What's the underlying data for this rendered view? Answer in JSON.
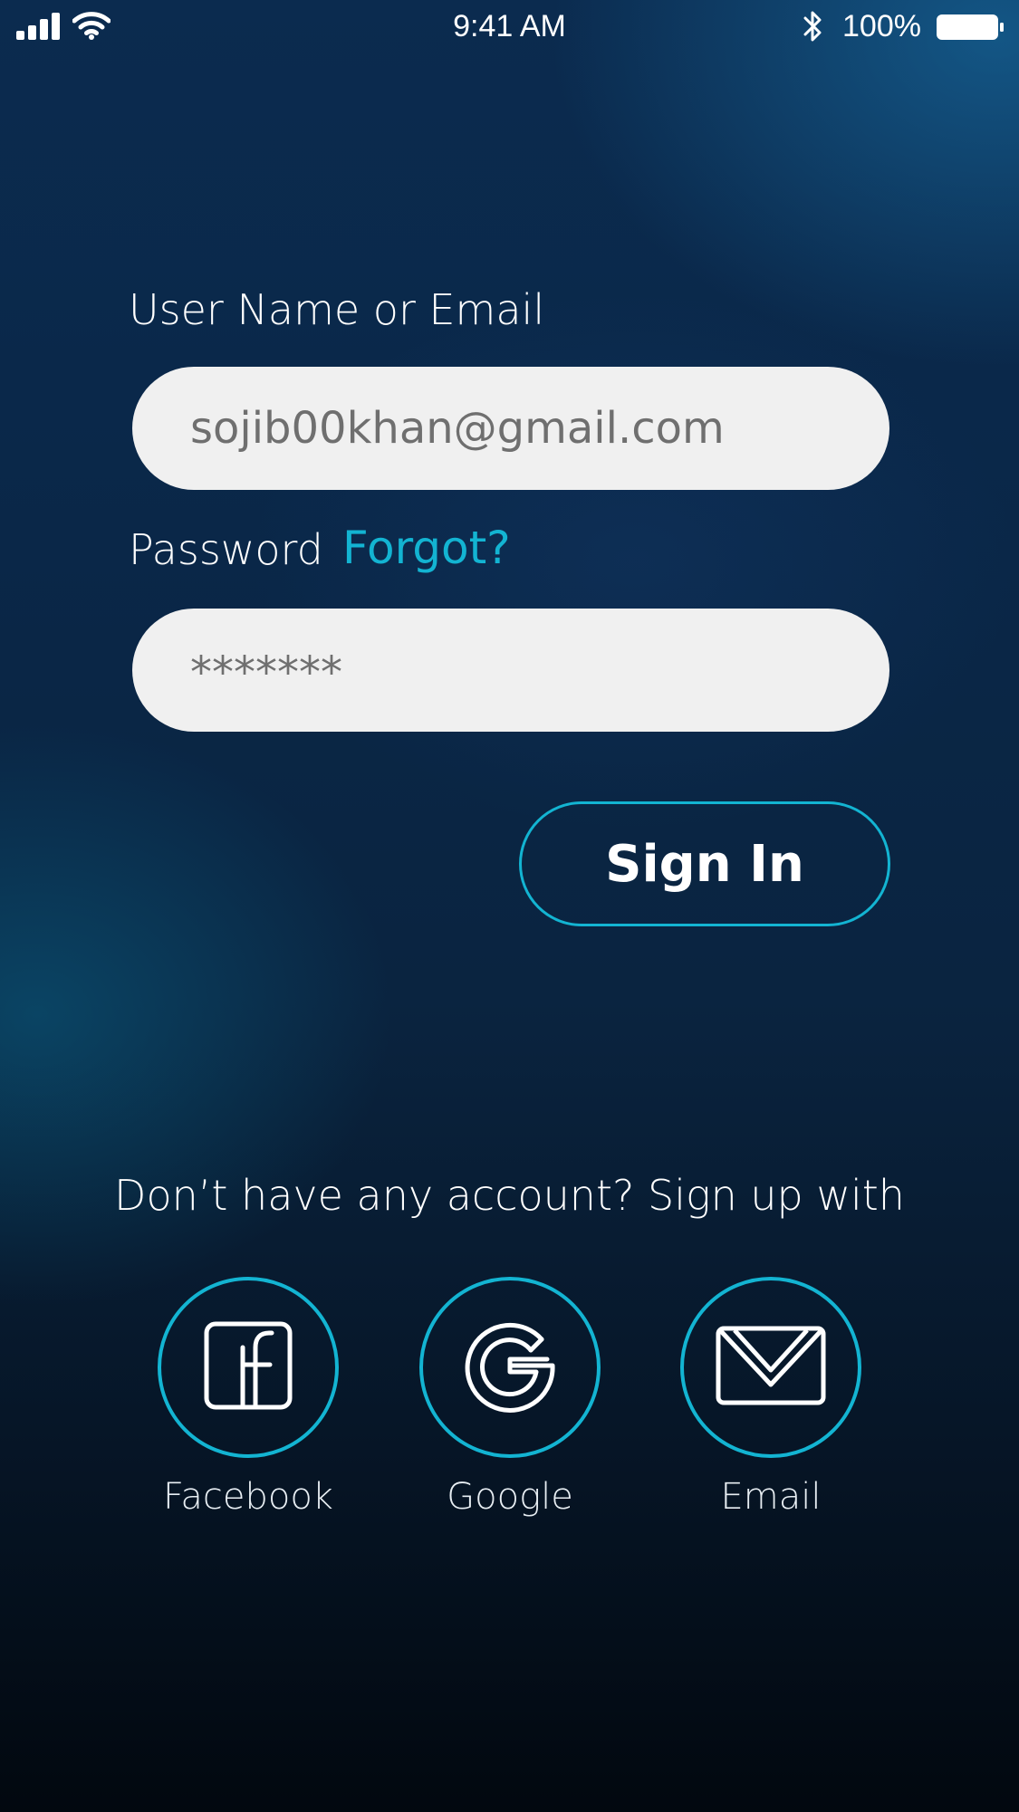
{
  "status_bar": {
    "time": "9:41 AM",
    "battery_percent": "100%",
    "icons": [
      "cellular-signal-icon",
      "wifi-icon",
      "bluetooth-icon",
      "battery-icon"
    ]
  },
  "login_form": {
    "username_label": "User Name or Email",
    "username_value": "sojib00khan@gmail.com",
    "password_label": "Password",
    "forgot_link": "Forgot?",
    "password_value": "*******",
    "sign_in_label": "Sign In"
  },
  "signup": {
    "prompt": "Don’t have any account? Sign up with",
    "providers": [
      {
        "label": "Facebook",
        "icon": "facebook-icon"
      },
      {
        "label": "Google",
        "icon": "google-icon"
      },
      {
        "label": "Email",
        "icon": "envelope-icon"
      }
    ]
  },
  "colors": {
    "accent": "#13b4d2",
    "field_background": "#f0f0f0",
    "field_text": "#6f6f6f",
    "background_top": "#0b2b4f",
    "background_bottom": "#02080f"
  }
}
